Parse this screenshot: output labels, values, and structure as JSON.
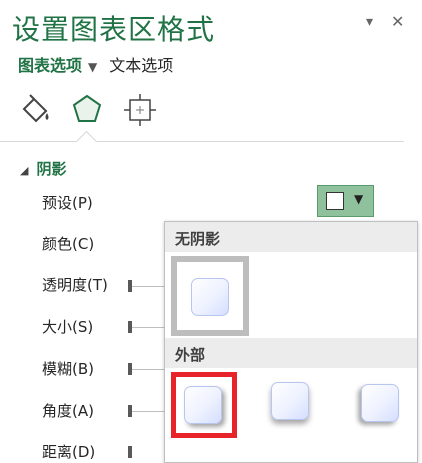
{
  "pane": {
    "title": "设置图表区格式",
    "tabs": {
      "active": "图表选项",
      "inactive": "文本选项"
    },
    "controls": {
      "dropdown_glyph": "▾",
      "close_glyph": "✕"
    }
  },
  "icons": [
    "fill-line-icon",
    "effects-pentagon-icon",
    "size-properties-icon"
  ],
  "section": {
    "label": "阴影",
    "expanded": true
  },
  "properties": [
    {
      "label": "预设(P)"
    },
    {
      "label": "颜色(C)"
    },
    {
      "label": "透明度(T)"
    },
    {
      "label": "大小(S)"
    },
    {
      "label": "模糊(B)"
    },
    {
      "label": "角度(A)"
    },
    {
      "label": "距离(D)"
    }
  ],
  "presets_dropdown": {
    "groups": [
      {
        "label": "无阴影",
        "items": [
          "no-shadow"
        ]
      },
      {
        "label": "外部",
        "items": [
          "outer-shadow-1",
          "outer-shadow-2",
          "outer-shadow-3"
        ]
      }
    ]
  },
  "colors": {
    "accent": "#217346",
    "selected_red": "#e8242a",
    "button_green": "#8fc29c"
  }
}
